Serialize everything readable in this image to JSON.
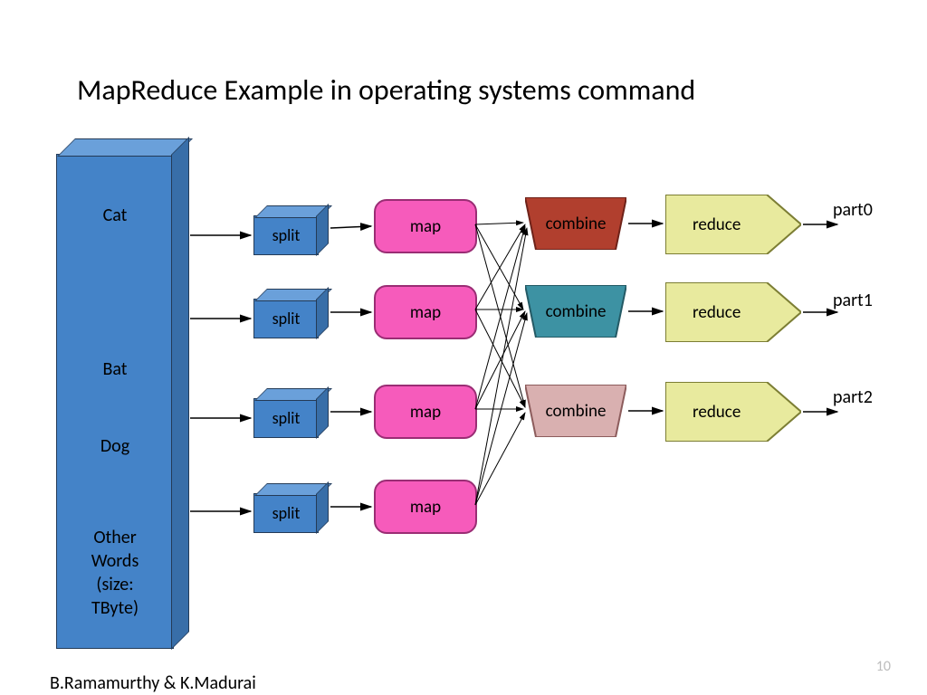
{
  "title": "MapReduce Example in operating systems command",
  "author": "B.Ramamurthy & K.Madurai",
  "slideNumber": "10",
  "input": {
    "words": [
      "Cat",
      "Bat",
      "Dog",
      "Other\nWords\n(size:\nTByte)"
    ]
  },
  "splitLabel": "split",
  "mapLabel": "map",
  "combineLabel": "combine",
  "reduceLabel": "reduce",
  "outputs": [
    "part0",
    "part1",
    "part2"
  ],
  "colors": {
    "combine": [
      "#b13f2e",
      "#3d92a3",
      "#d9b0b0"
    ],
    "reduceFill": "#e8ea9e",
    "mapFill": "#f65bbb",
    "splitFill": "#4483c8"
  }
}
